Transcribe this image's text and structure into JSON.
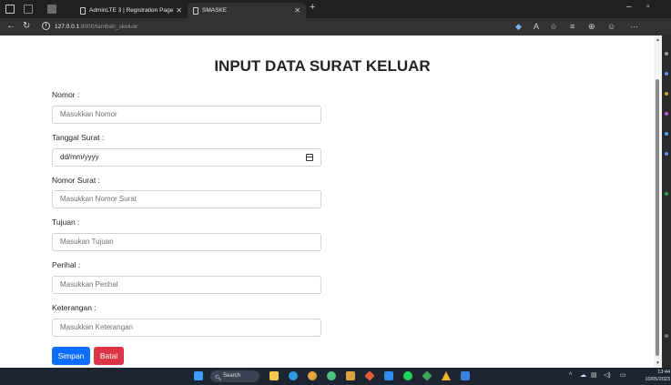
{
  "browser": {
    "tabs": [
      {
        "label": "AdminLTE 3 | Registration Page"
      },
      {
        "label": "SMASKE"
      }
    ],
    "url_host": "127.0.0.1",
    "url_path": ":8000/tambah_skeluar"
  },
  "page": {
    "title": "INPUT DATA SURAT KELUAR"
  },
  "form": {
    "nomor": {
      "label": "Nomor :",
      "placeholder": "Masukkan Nomor"
    },
    "tanggal": {
      "label": "Tanggal Surat :",
      "placeholder": "dd/mm/yyyy"
    },
    "nomor_surat": {
      "label": "Nomor Surat :",
      "placeholder": "Masukkan Nomor Surat"
    },
    "tujuan": {
      "label": "Tujuan :",
      "placeholder": "Masukan Tujuan"
    },
    "perihal": {
      "label": "Perihal :",
      "placeholder": "Masukkan Perihal"
    },
    "keterangan": {
      "label": "Keterangan :",
      "placeholder": "Masukkan Keterangan"
    },
    "buttons": {
      "save": "Simpan",
      "cancel": "Batal"
    }
  },
  "taskbar": {
    "search_label": "Search",
    "time": "13:44",
    "date": "10/05/2023"
  },
  "colors": {
    "primary": "#0d6efd",
    "danger": "#dc3545",
    "browser_dark": "#202020",
    "taskbar": "#1d2533"
  }
}
